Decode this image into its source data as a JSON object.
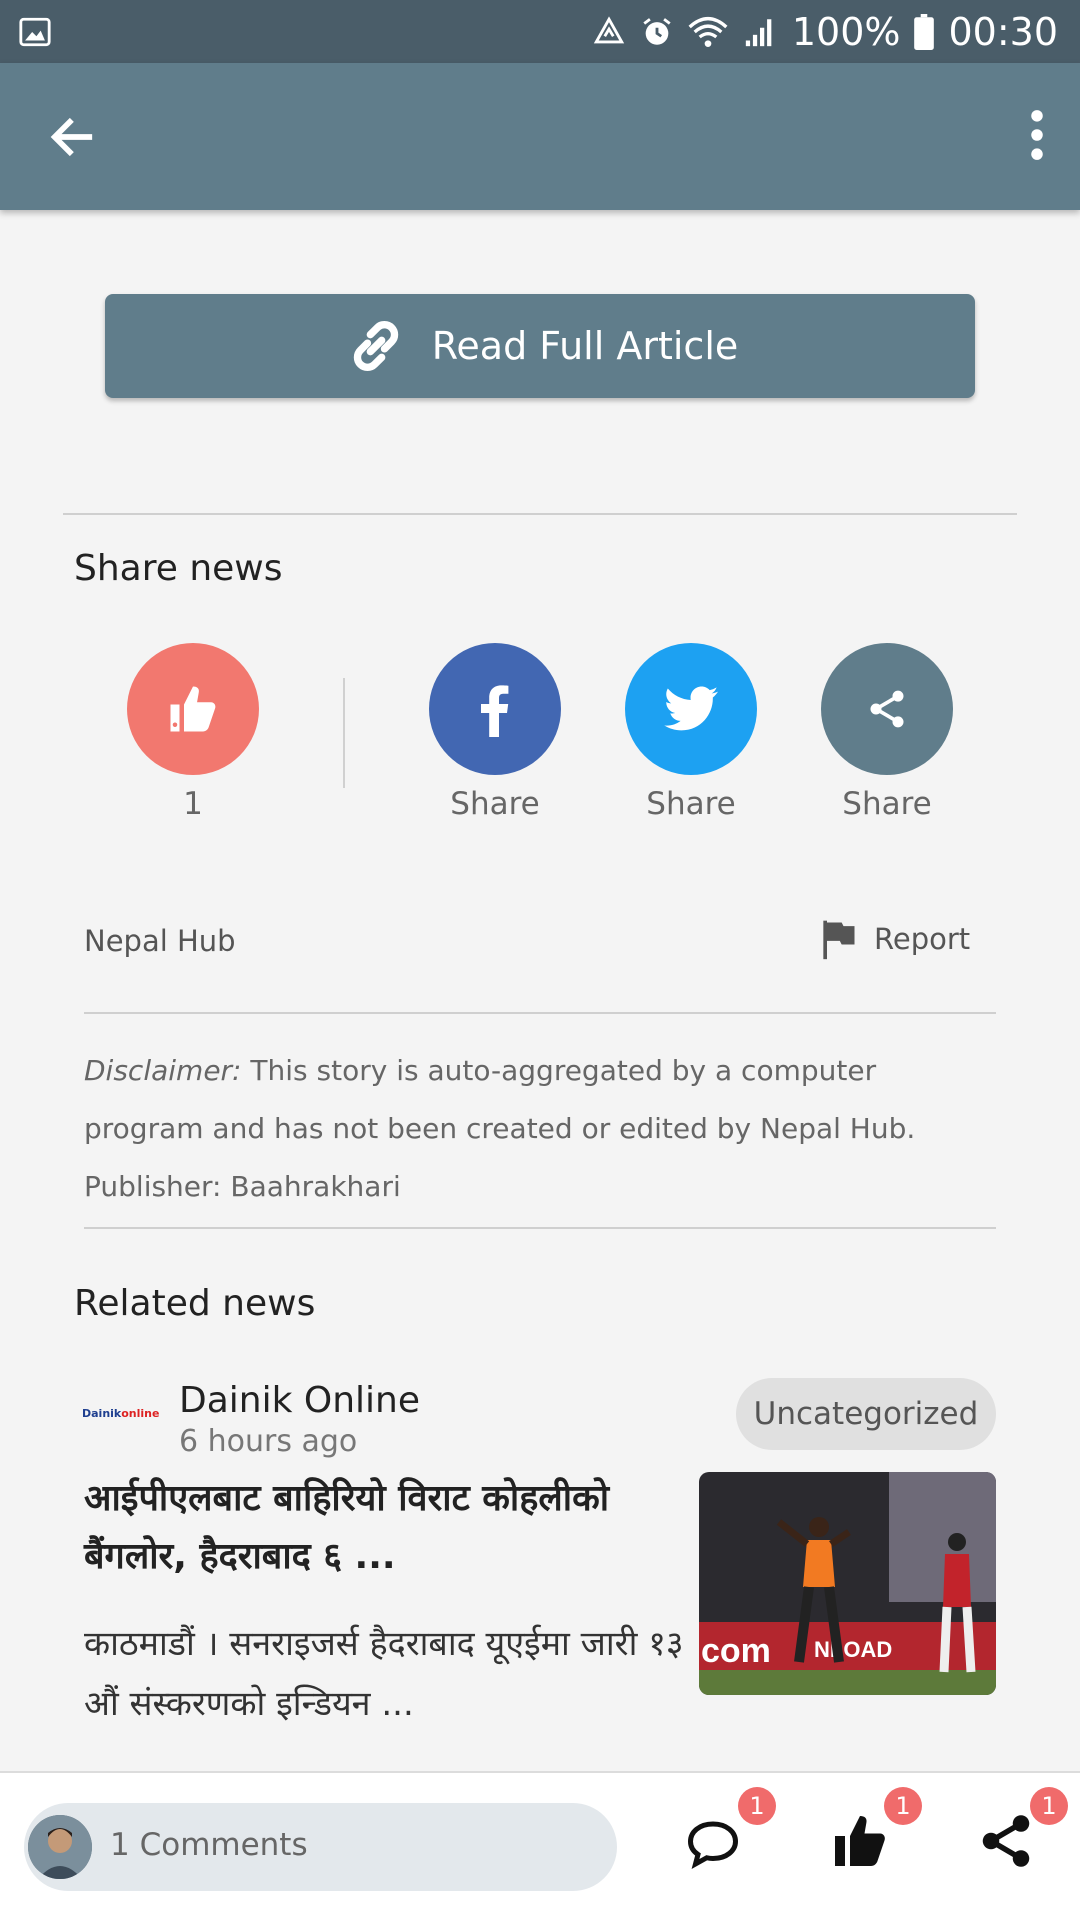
{
  "status_bar": {
    "battery": "100%",
    "time": "00:30",
    "icons": [
      "image-icon",
      "data-saver-icon",
      "alarm-icon",
      "wifi-icon",
      "signal-icon",
      "battery-icon"
    ]
  },
  "app_bar": {
    "back_icon": "arrow-left-icon",
    "menu_icon": "more-vert-icon"
  },
  "article": {
    "read_full_label": "Read Full Article"
  },
  "share": {
    "title": "Share news",
    "like_count": "1",
    "facebook_label": "Share",
    "twitter_label": "Share",
    "more_label": "Share"
  },
  "source": {
    "name": "Nepal Hub",
    "report_label": "Report"
  },
  "disclaimer": {
    "label": "Disclaimer:",
    "text": "This story is auto-aggregated by a computer program and has not been created or edited by Nepal Hub.",
    "publisher": "Publisher: Baahrakhari"
  },
  "related": {
    "title": "Related news",
    "items": [
      {
        "logo_text": "Dainik",
        "logo_accent": "online",
        "source": "Dainik Online",
        "time": "6 hours ago",
        "category": "Uncategorized",
        "headline": "आईपीएलबाट बाहिरियो विराट कोहलीको बैंगलोर, हैदराबाद ६ ...",
        "summary": "काठमाडौं । सनराइजर्स हैदराबाद यूएईमा जारी १३ औं संस्करणको इन्डियन ...",
        "thumb_banner_left": "com",
        "thumb_banner_right": "NLOAD"
      }
    ]
  },
  "bottom_bar": {
    "comments_label": "1 Comments",
    "comment_badge": "1",
    "like_badge": "1",
    "share_badge": "1"
  },
  "colors": {
    "primary": "#607d8b",
    "status_bar": "#4a5d69",
    "like": "#f2786f",
    "facebook": "#4267b2",
    "twitter": "#1da1f2",
    "badge": "#f06b6b"
  }
}
